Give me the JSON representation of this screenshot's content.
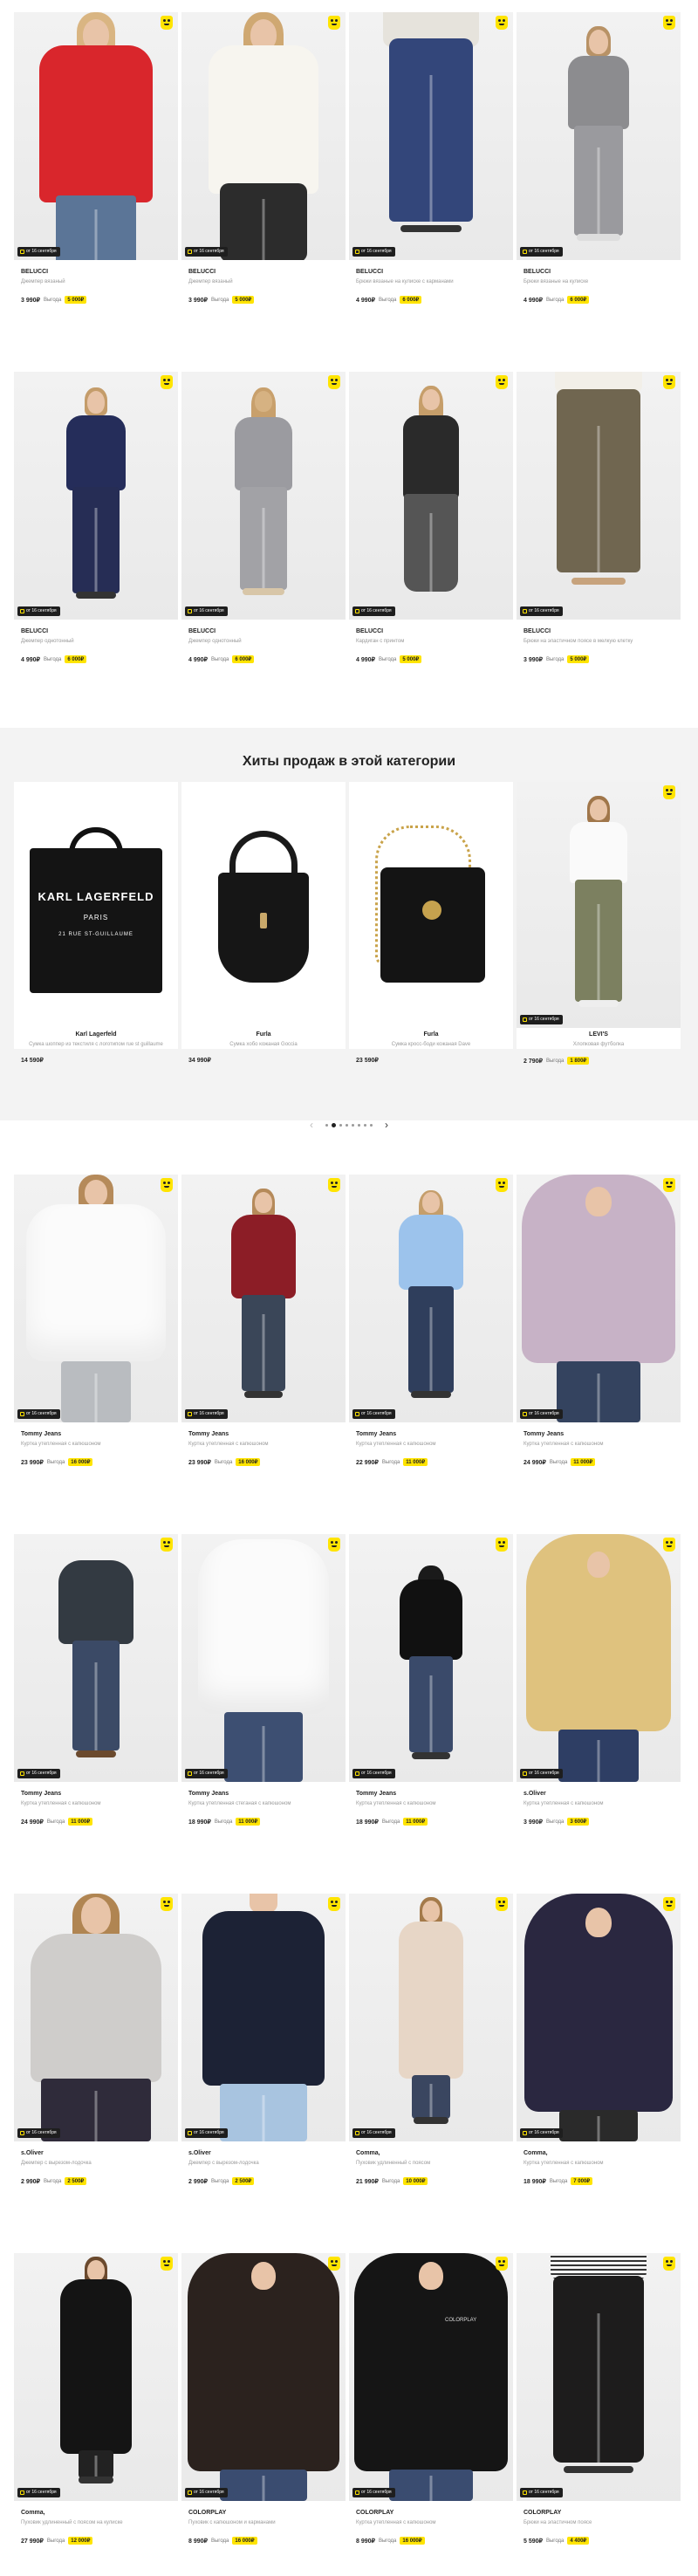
{
  "badge_text": "от 16 сентября",
  "savings_label": "Выгода",
  "hits_title": "Хиты продаж в этой категории",
  "colors": {
    "accent": "#ffe400",
    "badge_bg": "#1e1e1e"
  },
  "rows": [
    [
      {
        "brand": "BELUCCI",
        "desc": "Джемпер вязаный",
        "price": "3 990₽",
        "save": "5 000₽"
      },
      {
        "brand": "BELUCCI",
        "desc": "Джемпер вязаный",
        "price": "3 990₽",
        "save": "5 000₽"
      },
      {
        "brand": "BELUCCI",
        "desc": "Брюки вязаные на кулиске с карманами",
        "price": "4 990₽",
        "save": "6 000₽"
      },
      {
        "brand": "BELUCCI",
        "desc": "Брюки вязаные на кулиске",
        "price": "4 990₽",
        "save": "6 000₽"
      }
    ],
    [
      {
        "brand": "BELUCCI",
        "desc": "Джемпер однотонный",
        "price": "4 990₽",
        "save": "6 000₽"
      },
      {
        "brand": "BELUCCI",
        "desc": "Джемпер однотонный",
        "price": "4 990₽",
        "save": "6 000₽"
      },
      {
        "brand": "BELUCCI",
        "desc": "Кардиган с принтом",
        "price": "4 990₽",
        "save": "5 000₽"
      },
      {
        "brand": "BELUCCI",
        "desc": "Брюки на эластичном поясе в мелкую клетку",
        "price": "3 990₽",
        "save": "5 000₽"
      }
    ],
    [
      {
        "brand": "Tommy Jeans",
        "desc": "Куртка утепленная с капюшоном",
        "price": "23 990₽",
        "save": "16 000₽"
      },
      {
        "brand": "Tommy Jeans",
        "desc": "Куртка утепленная с капюшоном",
        "price": "23 990₽",
        "save": "16 000₽"
      },
      {
        "brand": "Tommy Jeans",
        "desc": "Куртка утепленная с капюшоном",
        "price": "22 990₽",
        "save": "11 000₽"
      },
      {
        "brand": "Tommy Jeans",
        "desc": "Куртка утепленная с капюшоном",
        "price": "24 990₽",
        "save": "11 000₽"
      }
    ],
    [
      {
        "brand": "Tommy Jeans",
        "desc": "Куртка утепленная с капюшоном",
        "price": "24 990₽",
        "save": "11 000₽"
      },
      {
        "brand": "Tommy Jeans",
        "desc": "Куртка утепленная стеганая с капюшоном",
        "price": "18 990₽",
        "save": "11 000₽"
      },
      {
        "brand": "Tommy Jeans",
        "desc": "Куртка утепленная с капюшоном",
        "price": "18 990₽",
        "save": "11 000₽"
      },
      {
        "brand": "s.Oliver",
        "desc": "Куртка утепленная с капюшоном",
        "price": "3 990₽",
        "save": "3 600₽"
      }
    ],
    [
      {
        "brand": "s.Oliver",
        "desc": "Джемпер с вырезом-лодочка",
        "price": "2 990₽",
        "save": "2 500₽"
      },
      {
        "brand": "s.Oliver",
        "desc": "Джемпер с вырезом-лодочка",
        "price": "2 990₽",
        "save": "2 500₽"
      },
      {
        "brand": "Comma,",
        "desc": "Пуховик удлиненный с поясом",
        "price": "21 990₽",
        "save": "10 000₽"
      },
      {
        "brand": "Comma,",
        "desc": "Куртка утепленная с капюшоном",
        "price": "18 990₽",
        "save": "7 000₽"
      }
    ],
    [
      {
        "brand": "Comma,",
        "desc": "Пуховик удлиненный с поясом на кулиске",
        "price": "27 990₽",
        "save": "12 000₽"
      },
      {
        "brand": "COLORPLAY",
        "desc": "Пуховик с капюшоном и карманами",
        "price": "8 990₽",
        "save": "16 000₽"
      },
      {
        "brand": "COLORPLAY",
        "desc": "Куртка утепленная с капюшоном",
        "price": "8 990₽",
        "save": "16 000₽"
      },
      {
        "brand": "COLORPLAY",
        "desc": "Брюки на эластичном поясе",
        "price": "5 590₽",
        "save": "4 400₽"
      }
    ]
  ],
  "hits": [
    {
      "brand": "Karl Lagerfeld",
      "desc": "Сумка шоппер из текстиля с логотипом rue st guillaume",
      "price": "14 590₽",
      "save": ""
    },
    {
      "brand": "Furla",
      "desc": "Сумка хобо кожаная Goccia",
      "price": "34 990₽",
      "save": ""
    },
    {
      "brand": "Furla",
      "desc": "Сумка кросс-боди кожаная Dave",
      "price": "23 590₽",
      "save": ""
    },
    {
      "brand": "LEVI'S",
      "desc": "Хлопковая футболка",
      "price": "2 790₽",
      "save": "1 800₽"
    }
  ],
  "bag_print": [
    "KARL LAGERFELD",
    "PARIS",
    "21 RUE ST-GUILLAUME"
  ],
  "jacket_logo": "COLORPLAY"
}
